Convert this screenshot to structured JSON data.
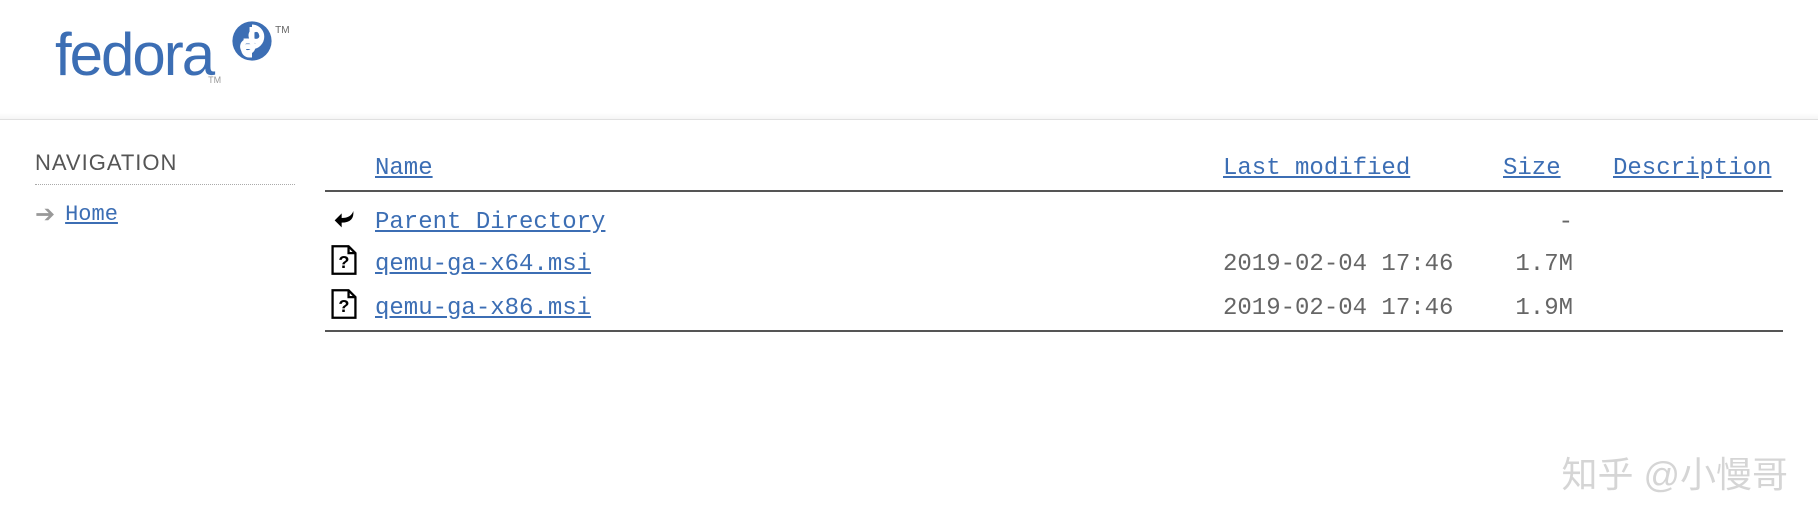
{
  "logo": {
    "text": "fedora",
    "tm": "TM"
  },
  "sidebar": {
    "title": "NAVIGATION",
    "items": [
      {
        "label": "Home"
      }
    ]
  },
  "listing": {
    "headers": {
      "name": "Name",
      "modified": "Last modified",
      "size": "Size",
      "description": "Description"
    },
    "rows": [
      {
        "icon": "back",
        "name": "Parent Directory",
        "modified": "",
        "size": "-",
        "description": ""
      },
      {
        "icon": "unknown",
        "name": "qemu-ga-x64.msi",
        "modified": "2019-02-04 17:46",
        "size": "1.7M",
        "description": ""
      },
      {
        "icon": "unknown",
        "name": "qemu-ga-x86.msi",
        "modified": "2019-02-04 17:46",
        "size": "1.9M",
        "description": ""
      }
    ]
  },
  "watermark": "知乎 @小慢哥"
}
